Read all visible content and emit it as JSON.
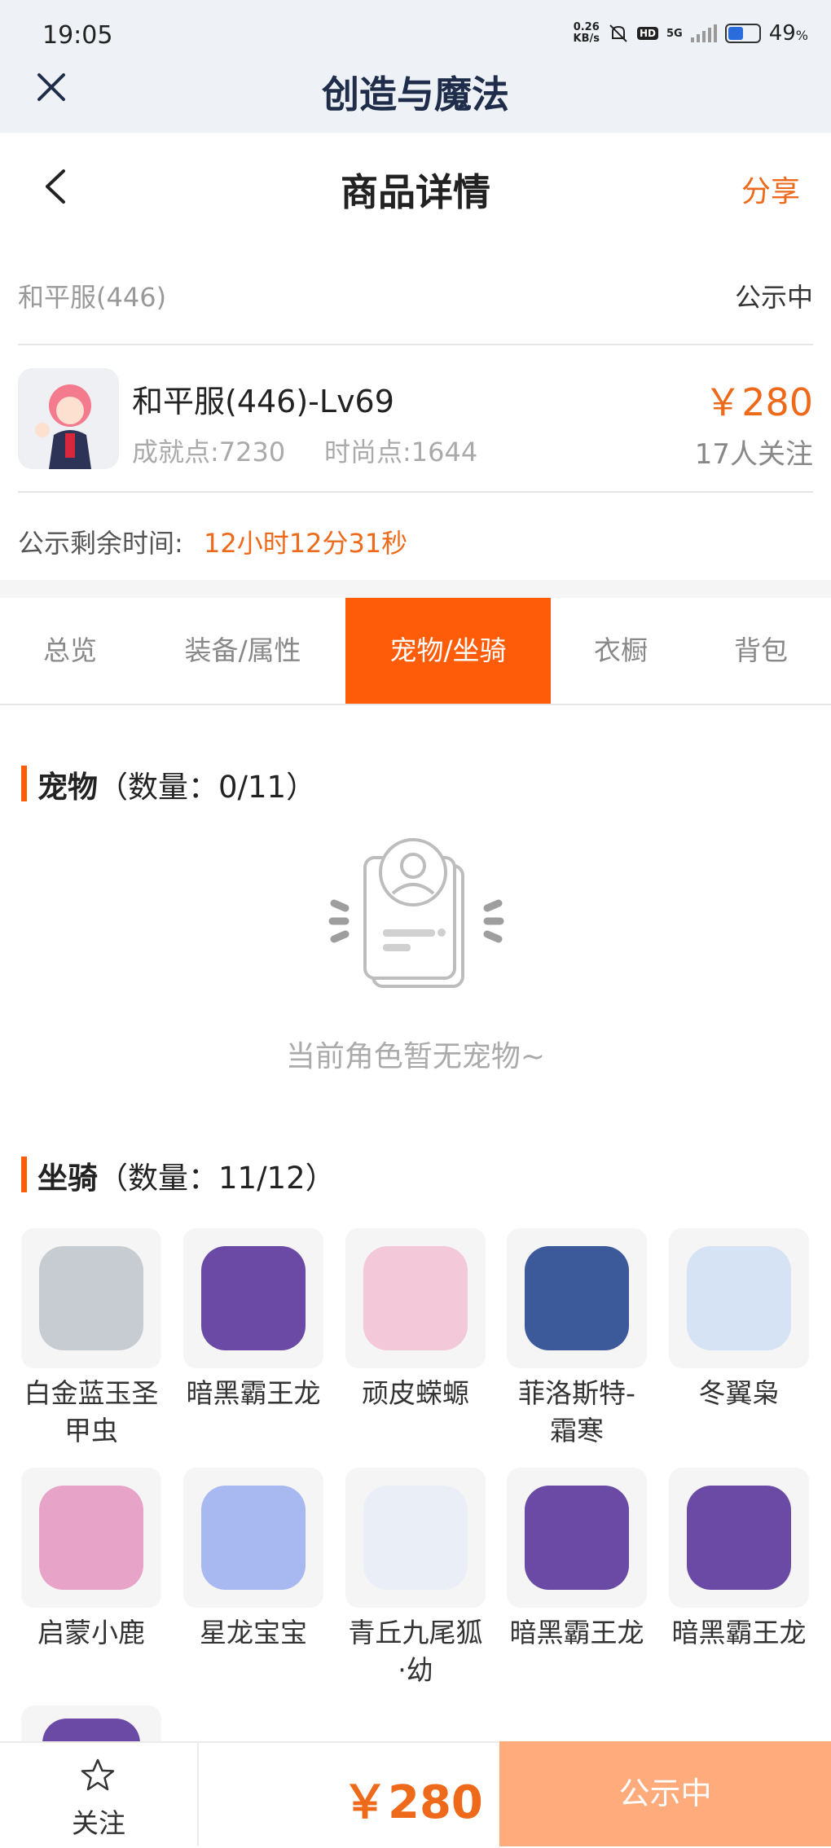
{
  "status_bar": {
    "time": "19:05",
    "speed_value": "0.26",
    "speed_unit": "KB/s",
    "hd": "HD",
    "network": "5G",
    "battery": "49",
    "battery_unit": "%"
  },
  "app": {
    "title": "创造与魔法"
  },
  "header": {
    "title": "商品详情",
    "share": "分享"
  },
  "listing": {
    "server": "和平服(446)",
    "status": "公示中",
    "name": "和平服(446)-Lv69",
    "achievement": "成就点:7230",
    "fashion": "时尚点:1644",
    "price": "￥280",
    "followers": "17人关注",
    "timer_label": "公示剩余时间:",
    "timer_value": "12小时12分31秒"
  },
  "tabs": [
    {
      "label": "总览"
    },
    {
      "label": "装备/属性"
    },
    {
      "label": "宠物/坐骑"
    },
    {
      "label": "衣橱"
    },
    {
      "label": "背包"
    }
  ],
  "pets": {
    "title": "宠物",
    "count": "（数量：0/11）",
    "empty_text": "当前角色暂无宠物~"
  },
  "mounts": {
    "title": "坐骑",
    "count": "（数量：11/12）",
    "items": [
      {
        "name": "白金蓝玉圣甲虫",
        "color": "#c7ccd3"
      },
      {
        "name": "暗黑霸王龙",
        "color": "#6b4aa6"
      },
      {
        "name": "顽皮蝾螈",
        "color": "#f3c8d8"
      },
      {
        "name": "菲洛斯特-霜寒",
        "color": "#3c5a9a"
      },
      {
        "name": "冬翼枭",
        "color": "#d6e3f5"
      },
      {
        "name": "启蒙小鹿",
        "color": "#e8a3c9"
      },
      {
        "name": "星龙宝宝",
        "color": "#a8b8f0"
      },
      {
        "name": "青丘九尾狐·幼",
        "color": "#eaeef6"
      },
      {
        "name": "暗黑霸王龙",
        "color": "#6b4aa6"
      },
      {
        "name": "暗黑霸王龙",
        "color": "#6b4aa6"
      }
    ]
  },
  "bottom": {
    "follow": "关注",
    "price": "￥280",
    "status_button": "公示中"
  },
  "colors": {
    "accent": "#ff5c0a",
    "price": "#ee6a1a",
    "button_disabled": "#ffab7c"
  }
}
